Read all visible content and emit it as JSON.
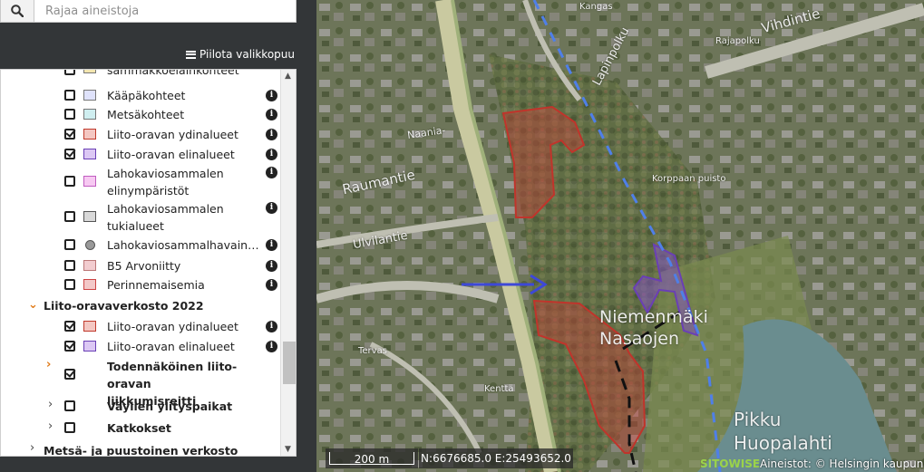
{
  "search": {
    "placeholder": "Rajaa aineistoja"
  },
  "toolbar": {
    "hide_tree_label": "Piilota valikkopuu"
  },
  "layers": [
    {
      "label": "sammakkoeläinkohteet",
      "checked": false,
      "swatch": "#f3e6b0",
      "info": false
    },
    {
      "label": "Kääpäkohteet",
      "checked": false,
      "swatch": "#dfe2fb",
      "info": true
    },
    {
      "label": "Metsäkohteet",
      "checked": false,
      "swatch": "#cfeef0",
      "info": true
    },
    {
      "label": "Liito-oravan ydinalueet",
      "checked": true,
      "swatch": "#f4c7c2",
      "info": true
    },
    {
      "label": "Liito-oravan elinalueet",
      "checked": true,
      "swatch": "#dcc8f4",
      "info": true
    },
    {
      "label": "Lahokaviosammalen elinympäristöt",
      "checked": false,
      "swatch": "#f7c9f2",
      "info": true
    },
    {
      "label": "Lahokaviosammalen tukialueet",
      "checked": false,
      "swatch": "#d9d9d9",
      "info": true
    },
    {
      "label": "Lahokaviosammalhavain…",
      "checked": false,
      "swatch": "#999999",
      "info": true
    },
    {
      "label": "B5 Arvoniitty",
      "checked": false,
      "swatch": "#f2cccf",
      "info": true
    },
    {
      "label": "Perinnemaisemia",
      "checked": false,
      "swatch": "#f3c8c8",
      "info": true
    }
  ],
  "group_2022": {
    "label": "Liito-oravaverkosto 2022",
    "items": [
      {
        "label": "Liito-oravan ydinalueet",
        "checked": true,
        "swatch": "#f4c7c2"
      },
      {
        "label": "Liito-oravan elinalueet",
        "checked": true,
        "swatch": "#dcc8f4"
      }
    ],
    "subgroups": [
      {
        "label": "Todennäköinen liito-oravan liikkumisreitti",
        "checked": true
      },
      {
        "label": "Väylien ylityspaikat",
        "checked": false
      },
      {
        "label": "Katkokset",
        "checked": false
      }
    ]
  },
  "group_forest": {
    "label": "Metsä- ja puustoinen verkosto"
  },
  "map": {
    "labels": {
      "lapinpolku": "Lapinpolku",
      "vihdintie": "Vihdintie",
      "rajapolku": "Rajapolku",
      "kangas": "Kangas",
      "naania": "Naania-",
      "raumantie": "Raumantie",
      "ulvilantie": "Ulvilantie",
      "karpanen": "Korppaan puisto",
      "niemen": "Niemenmäki Nasaojen",
      "pikku": "Pikku Huopalahti",
      "kentta": "Kenttä",
      "mindstorms": "Tervas"
    },
    "scale_label": "200 m",
    "coords": "N:6676685.0 E:25493652.0",
    "brand": "SITOWISE",
    "attribution": "Aineistot: © Helsingin kaupunki"
  }
}
